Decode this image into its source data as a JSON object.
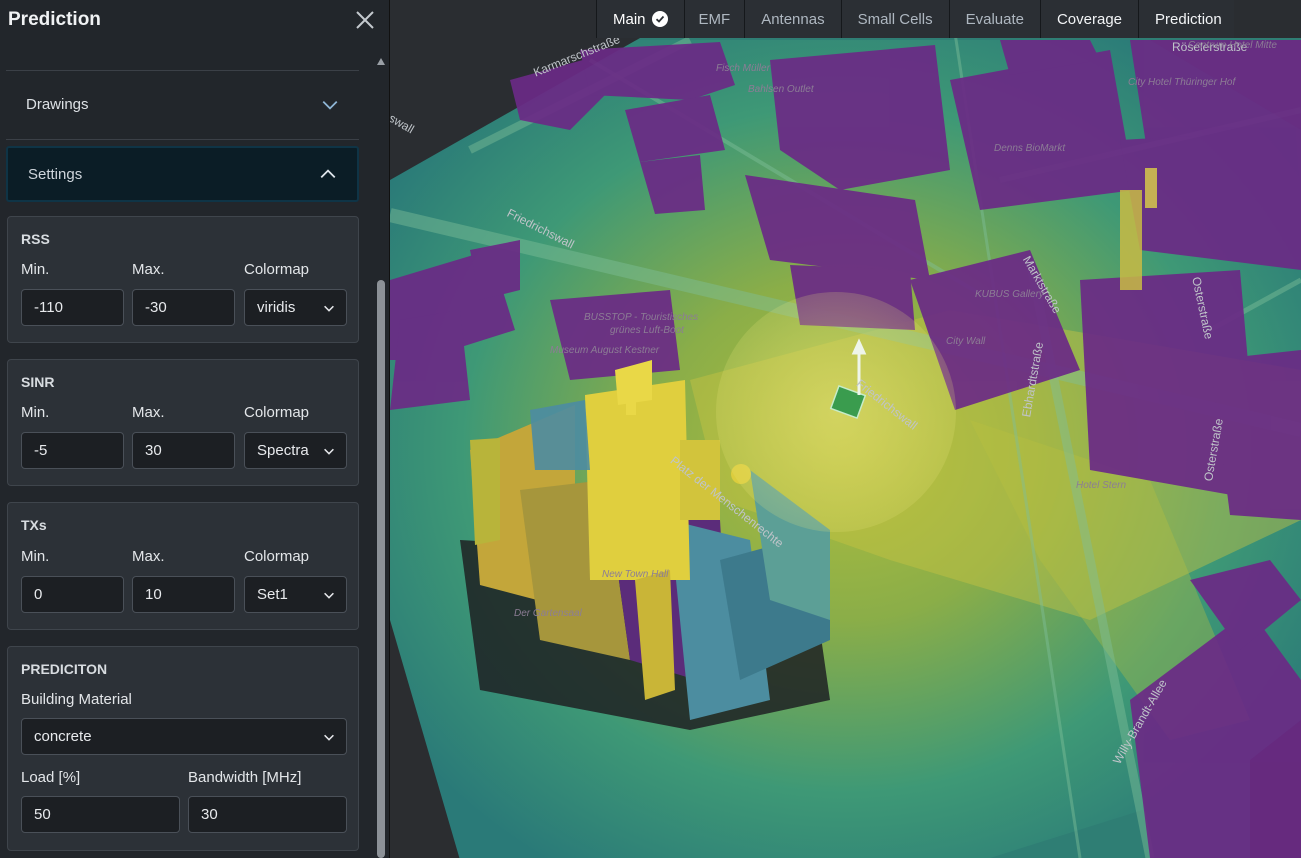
{
  "sidebar": {
    "title": "Prediction",
    "accordion": {
      "drawings_label": "Drawings",
      "settings_label": "Settings"
    },
    "rss": {
      "title": "RSS",
      "min_label": "Min.",
      "max_label": "Max.",
      "colormap_label": "Colormap",
      "min_value": "-110",
      "max_value": "-30",
      "colormap_value": "viridis"
    },
    "sinr": {
      "title": "SINR",
      "min_label": "Min.",
      "max_label": "Max.",
      "colormap_label": "Colormap",
      "min_value": "-5",
      "max_value": "30",
      "colormap_value": "Spectra"
    },
    "txs": {
      "title": "TXs",
      "min_label": "Min.",
      "max_label": "Max.",
      "colormap_label": "Colormap",
      "min_value": "0",
      "max_value": "10",
      "colormap_value": "Set1"
    },
    "prediction": {
      "title": "PREDICITON",
      "material_label": "Building Material",
      "material_value": "concrete",
      "load_label": "Load [%]",
      "load_value": "50",
      "bandwidth_label": "Bandwidth [MHz]",
      "bandwidth_value": "30"
    }
  },
  "nav": {
    "tabs": [
      "Main",
      "EMF",
      "Antennas",
      "Small Cells",
      "Evaluate",
      "Coverage",
      "Prediction"
    ],
    "active": "Main"
  },
  "map": {
    "streets": {
      "karmarschstrasse": "Karmarschstraße",
      "friedrichswall_1": "Friedrichswall",
      "friedrichswall_2": "Friedrichswall",
      "marktstrasse": "Marktstraße",
      "osterstrasse_1": "Osterstraße",
      "osterstrasse_2": "Osterstraße",
      "ebhardtstrasse": "Ebhardtstraße",
      "willy_brandt": "Willy-Brandt-Allee",
      "roeselerstrasse": "Röselerstraße",
      "platz": "Platz der Menschenrechte",
      "wall": "swall"
    },
    "pois": {
      "fisch_mueller": "Fisch Müller",
      "bahlsen": "Bahlsen Outlet",
      "centrum": "Centrum Hotel Mitte",
      "hotel_thueringer": "City Hotel Thüringer Hof",
      "denns": "Denns BioMarkt",
      "gallery": "KUBUS Gallery",
      "city_wall": "City Wall",
      "busstop": "BUSSTOP - Touristisches",
      "gruenes": "grünes Luft-Boot",
      "museum": "Museum August Kestner",
      "new_town_hall": "New Town Hall",
      "gartensaal": "Der Gartensaal",
      "hotel_stern": "Hotel Stern"
    }
  }
}
